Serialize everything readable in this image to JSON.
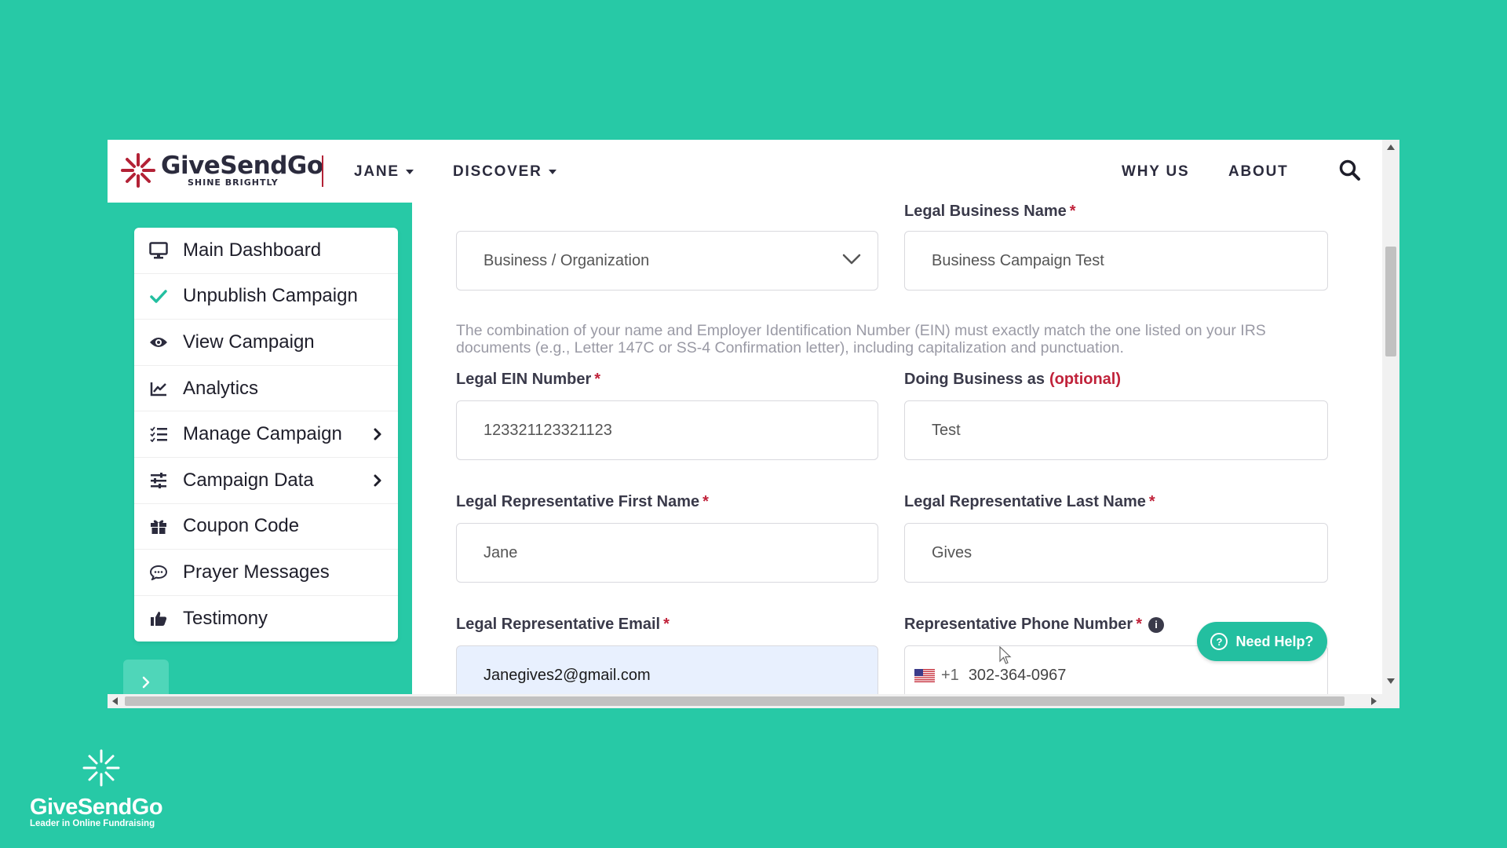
{
  "brand": {
    "name": "GiveSendGo",
    "tagline": "SHINE BRIGHTLY",
    "accent": "#b32236",
    "teal": "#27c9a6"
  },
  "nav": {
    "user": "JANE",
    "discover": "DISCOVER",
    "why_us": "WHY US",
    "about": "ABOUT"
  },
  "sidebar": {
    "items": [
      {
        "label": "Main Dashboard",
        "icon": "monitor-icon"
      },
      {
        "label": "Unpublish Campaign",
        "icon": "check-icon"
      },
      {
        "label": "View Campaign",
        "icon": "eye-icon"
      },
      {
        "label": "Analytics",
        "icon": "line-chart-icon"
      },
      {
        "label": "Manage Campaign",
        "icon": "list-check-icon"
      },
      {
        "label": "Campaign Data",
        "icon": "sliders-icon"
      },
      {
        "label": "Coupon Code",
        "icon": "gift-icon"
      },
      {
        "label": "Prayer Messages",
        "icon": "chat-bubble-icon"
      },
      {
        "label": "Testimony",
        "icon": "thumbs-up-icon"
      }
    ]
  },
  "form": {
    "entity_type": "Business / Organization",
    "legal_business_name_label": "Legal Business Name",
    "legal_business_name": "Business Campaign Test",
    "note": "The combination of your name and Employer Identification Number (EIN) must exactly match the one listed on your IRS documents (e.g., Letter 147C or SS-4 Confirmation letter), including capitalization and punctuation.",
    "ein_label": "Legal EIN Number",
    "ein": "123321123321123",
    "dba_label": "Doing Business as",
    "dba_optional": "(optional)",
    "dba": "Test",
    "first_name_label": "Legal Representative First Name",
    "first_name": "Jane",
    "last_name_label": "Legal Representative Last Name",
    "last_name": "Gives",
    "email_label": "Legal Representative Email",
    "email": "Janegives2@gmail.com",
    "phone_label": "Representative Phone Number",
    "phone_code": "+1",
    "phone": "302-364-0967",
    "required_mark": "*"
  },
  "help": {
    "label": "Need Help?"
  },
  "watermark": {
    "name": "GiveSendGo",
    "tagline": "Leader in Online Fundraising"
  }
}
